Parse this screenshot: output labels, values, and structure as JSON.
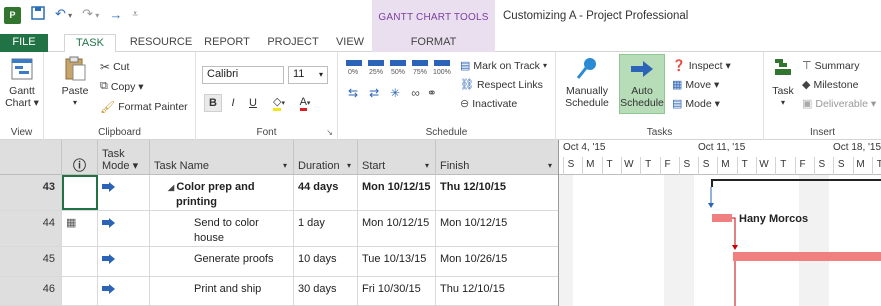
{
  "window": {
    "title": "Customizing A - Project Professional",
    "context_tab_group": "GANTT CHART TOOLS",
    "app_icon": "P",
    "accent": "#217346"
  },
  "qat": {
    "save": "save-icon",
    "undo": "undo-icon",
    "redo": "redo-icon",
    "forward": "forward-icon",
    "customize": "customize-qat-icon"
  },
  "tabs": [
    "FILE",
    "TASK",
    "RESOURCE",
    "REPORT",
    "PROJECT",
    "VIEW",
    "FORMAT"
  ],
  "ribbon": {
    "view": {
      "gantt_chart": "Gantt",
      "gantt_chart2": "Chart ▾",
      "label": "View"
    },
    "clipboard": {
      "paste": "Paste",
      "cut": "Cut",
      "copy": "Copy ▾",
      "format_painter": "Format Painter",
      "label": "Clipboard"
    },
    "font": {
      "family": "Calibri",
      "size": "11",
      "bold": "B",
      "italic": "I",
      "underline": "U",
      "label": "Font"
    },
    "schedule": {
      "mark_on_track": "Mark on Track",
      "respect_links": "Respect Links",
      "inactivate": "Inactivate",
      "pct": [
        "0%",
        "25%",
        "50%",
        "75%",
        "100%"
      ],
      "label": "Schedule"
    },
    "tasks": {
      "manually": "Manually",
      "schedule1": "Schedule",
      "auto": "Auto",
      "schedule2": "Schedule",
      "inspect": "Inspect ▾",
      "move": "Move ▾",
      "mode": "Mode ▾",
      "label": "Tasks"
    },
    "insert": {
      "task": "Task",
      "summary": "Summary",
      "milestone": "Milestone",
      "deliverable": "Deliverable ▾",
      "label": "Insert"
    }
  },
  "grid": {
    "headers": {
      "info": "ⓘ",
      "mode1": "Task",
      "mode2": "Mode ▾",
      "name": "Task Name",
      "duration": "Duration",
      "start": "Start",
      "finish": "Finish"
    },
    "rows": [
      {
        "id": "43",
        "name": "Color prep and",
        "name2": "printing",
        "duration": "44 days",
        "start": "Mon 10/12/15",
        "finish": "Thu 12/10/15",
        "summary": true
      },
      {
        "id": "44",
        "name": "Send to color",
        "name2": "house",
        "duration": "1 day",
        "start": "Mon 10/12/15",
        "finish": "Mon 10/12/15",
        "summary": false
      },
      {
        "id": "45",
        "name": "Generate proofs",
        "name2": "",
        "duration": "10 days",
        "start": "Tue 10/13/15",
        "finish": "Mon 10/26/15",
        "summary": false
      },
      {
        "id": "46",
        "name": "Print and ship",
        "name2": "",
        "duration": "30 days",
        "start": "Fri 10/30/15",
        "finish": "Thu 12/10/15",
        "summary": false
      }
    ]
  },
  "gantt": {
    "weeks": [
      "Oct 4, '15",
      "Oct 11, '15",
      "Oct 18, '15"
    ],
    "days": [
      "S",
      "M",
      "T",
      "W",
      "T",
      "F",
      "S",
      "S",
      "M",
      "T",
      "W",
      "T",
      "F",
      "S",
      "S",
      "M",
      "T"
    ],
    "resource_label": "Hany Morcos",
    "bar_color": "#f08080",
    "summary_color": "#222222"
  }
}
